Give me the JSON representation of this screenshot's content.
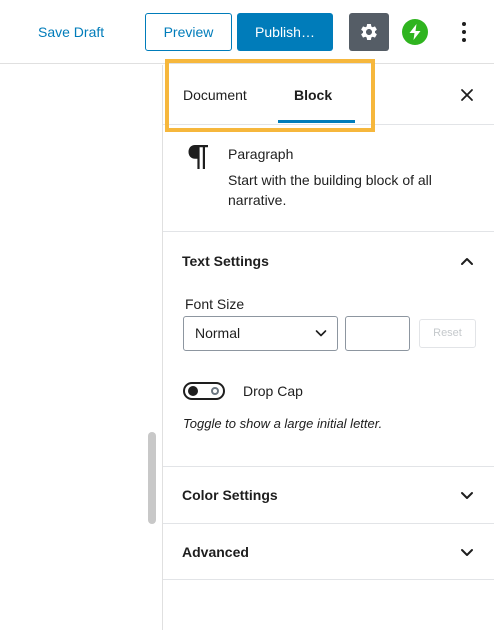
{
  "toolbar": {
    "save_draft": "Save Draft",
    "preview": "Preview",
    "publish": "Publish…"
  },
  "sidebar": {
    "tabs": [
      {
        "label": "Document",
        "active": false
      },
      {
        "label": "Block",
        "active": true
      }
    ],
    "block": {
      "icon": "paragraph-icon",
      "title": "Paragraph",
      "description": "Start with the building block of all narrative."
    },
    "text_settings": {
      "title": "Text Settings",
      "expanded": true,
      "font_size_label": "Font Size",
      "font_size_value": "Normal",
      "custom_size_value": "",
      "reset_label": "Reset",
      "drop_cap_label": "Drop Cap",
      "drop_cap_enabled": false,
      "drop_cap_help": "Toggle to show a large initial letter."
    },
    "color_settings": {
      "title": "Color Settings",
      "expanded": false
    },
    "advanced": {
      "title": "Advanced",
      "expanded": false
    }
  },
  "colors": {
    "accent": "#007cba",
    "settings_button": "#555d66",
    "jetpack": "#2fb41f",
    "highlight": "#f6b73c"
  }
}
